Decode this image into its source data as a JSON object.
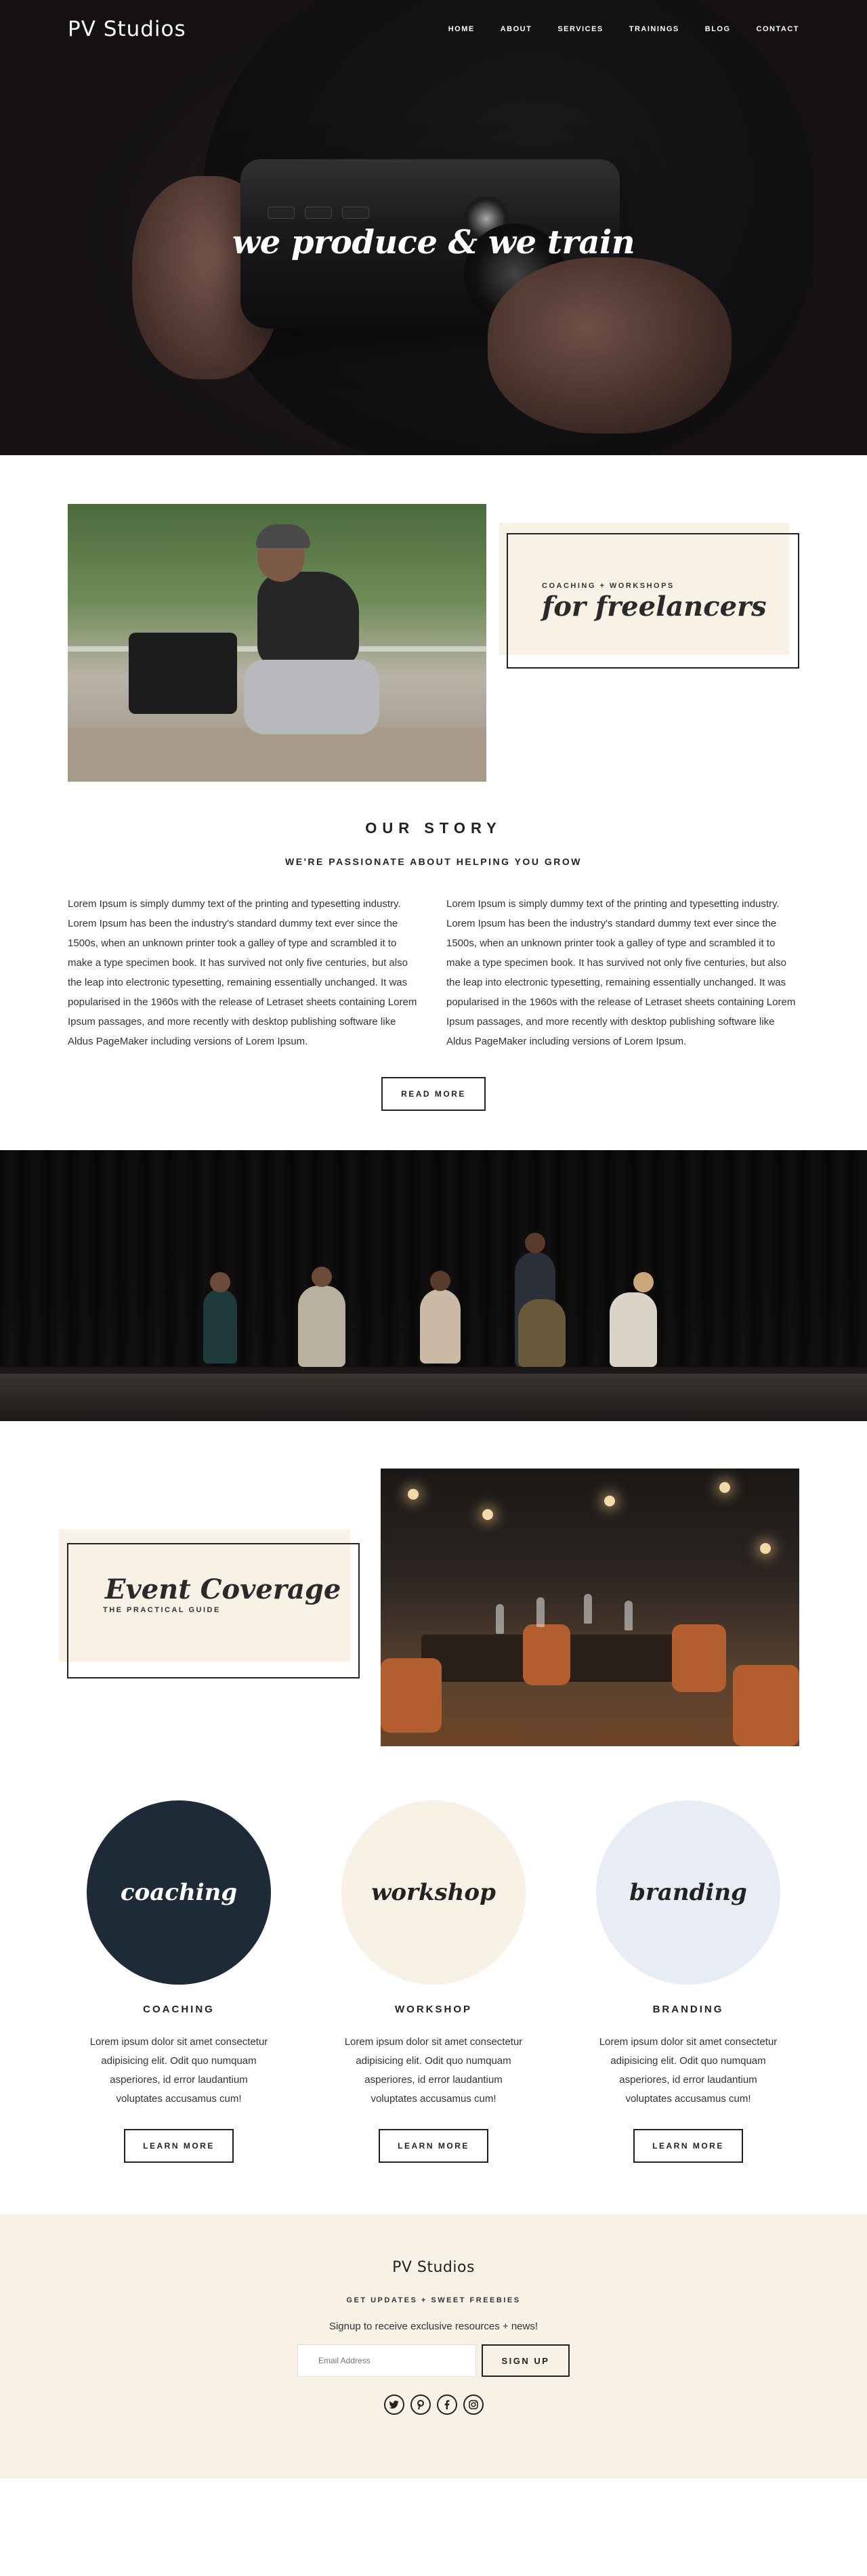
{
  "header": {
    "logo": "PV Studios",
    "nav": [
      "HOME",
      "ABOUT",
      "SERVICES",
      "TRAININGS",
      "BLOG",
      "CONTACT"
    ]
  },
  "hero": {
    "title": "we produce & we train"
  },
  "freelancers": {
    "subtitle": "COACHING + WORKSHOPS",
    "title": "for freelancers"
  },
  "story": {
    "heading": "OUR STORY",
    "subheading": "WE'RE PASSIONATE ABOUT HELPING YOU GROW",
    "col1": "Lorem Ipsum is simply dummy text of the printing and typesetting industry. Lorem Ipsum has been the industry's standard dummy text ever since the 1500s, when an unknown printer took a galley of type and scrambled it to make a type specimen book. It has survived not only five centuries, but also the leap into electronic typesetting, remaining essentially unchanged. It was popularised in the 1960s with the release of Letraset sheets containing Lorem Ipsum passages, and more recently with desktop publishing software like Aldus PageMaker including versions of Lorem Ipsum.",
    "col2": "Lorem Ipsum is simply dummy text of the printing and typesetting industry. Lorem Ipsum has been the industry's standard dummy text ever since the 1500s, when an unknown printer took a galley of type and scrambled it to make a type specimen book. It has survived not only five centuries, but also the leap into electronic typesetting, remaining essentially unchanged. It was popularised in the 1960s with the release of Letraset sheets containing Lorem Ipsum passages, and more recently with desktop publishing software like Aldus PageMaker including versions of Lorem Ipsum.",
    "read_more": "READ MORE"
  },
  "event": {
    "title": "Event Coverage",
    "subtitle": "THE PRACTICAL GUIDE"
  },
  "services": [
    {
      "circle_label": "coaching",
      "title": "COACHING",
      "desc": "Lorem ipsum dolor sit amet consectetur adipisicing elit. Odit quo numquam asperiores, id error laudantium voluptates accusamus cum!",
      "button": "LEARN MORE",
      "bg": "#1e2a38",
      "fg": "#ffffff"
    },
    {
      "circle_label": "workshop",
      "title": "WORKSHOP",
      "desc": "Lorem ipsum dolor sit amet consectetur adipisicing elit. Odit quo numquam asperiores, id error laudantium voluptates accusamus cum!",
      "button": "LEARN MORE",
      "bg": "#f7f1e6",
      "fg": "#222222"
    },
    {
      "circle_label": "branding",
      "title": "BRANDING",
      "desc": "Lorem ipsum dolor sit amet consectetur adipisicing elit. Odit quo numquam asperiores, id error laudantium voluptates accusamus cum!",
      "button": "LEARN MORE",
      "bg": "#e8ecf5",
      "fg": "#222222"
    }
  ],
  "footer": {
    "logo": "PV Studios",
    "tagline": "GET UPDATES + SWEET FREEBIES",
    "desc": "Signup to receive exclusive resources + news!",
    "email_placeholder": "Email Address",
    "signup": "SIGN UP",
    "social_icons": [
      "twitter-icon",
      "pinterest-icon",
      "facebook-icon",
      "instagram-icon"
    ]
  },
  "colors": {
    "cream": "#f7f1e6",
    "navy": "#1e2a38",
    "lightblue": "#e8ecf5",
    "ink": "#222222"
  }
}
